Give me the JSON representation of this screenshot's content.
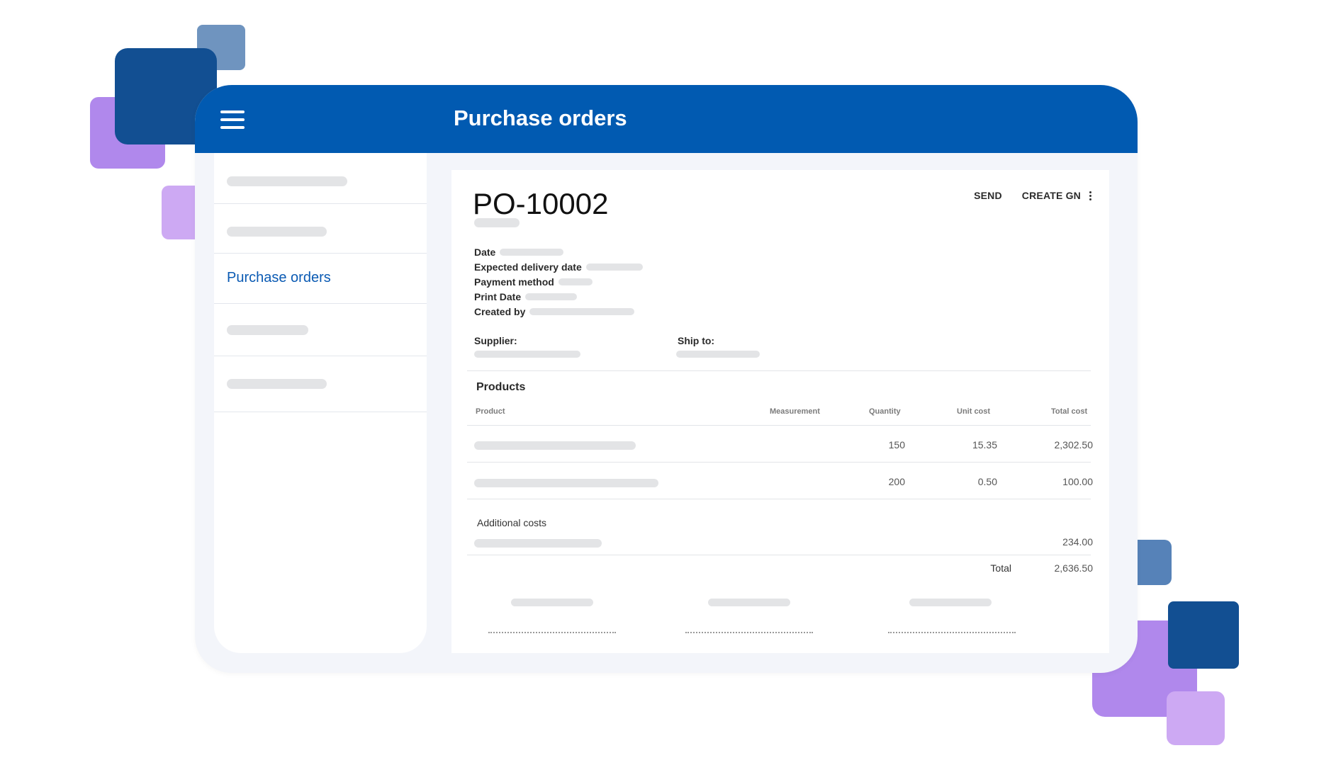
{
  "header": {
    "title": "Purchase orders"
  },
  "sidebar": {
    "items": [
      {
        "label": ""
      },
      {
        "label": ""
      },
      {
        "label": "Purchase orders"
      },
      {
        "label": ""
      },
      {
        "label": ""
      }
    ],
    "active_index": 2
  },
  "document": {
    "number": "PO-10002",
    "actions": {
      "send_label": "SEND",
      "create_gn_label": "CREATE GN"
    },
    "fields": {
      "date_label": "Date",
      "expected_delivery_label": "Expected delivery date",
      "payment_method_label": "Payment method",
      "print_date_label": "Print Date",
      "created_by_label": "Created by",
      "supplier_label": "Supplier:",
      "ship_to_label": "Ship to:"
    },
    "products": {
      "title": "Products",
      "columns": [
        "Product",
        "Measurement",
        "Quantity",
        "Unit cost",
        "Total cost"
      ],
      "rows": [
        {
          "product": "",
          "measurement": "",
          "quantity": "150",
          "unit_cost": "15.35",
          "total_cost": "2,302.50"
        },
        {
          "product": "",
          "measurement": "",
          "quantity": "200",
          "unit_cost": "0.50",
          "total_cost": "100.00"
        }
      ]
    },
    "additional_costs": {
      "title": "Additional costs",
      "amount": "234.00"
    },
    "total": {
      "label": "Total",
      "amount": "2,636.50"
    }
  },
  "colors": {
    "brand_blue": "#015ab1",
    "dark_blue": "#124f92",
    "purple": "#b088ec",
    "light_purple": "#cda9f3",
    "placeholder_gray": "#e3e4e6"
  },
  "icons": [
    "hamburger-menu-icon",
    "more-vertical-icon"
  ]
}
